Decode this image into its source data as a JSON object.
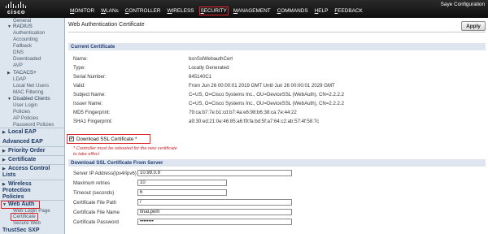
{
  "header": {
    "brand": "cisco",
    "top_right": "Saye Configuration",
    "nav": [
      {
        "key": "M",
        "rest": "ONITOR"
      },
      {
        "key": "W",
        "rest": "LANs"
      },
      {
        "key": "C",
        "rest": "ONTROLLER"
      },
      {
        "key": "W",
        "rest": "IRELESS"
      },
      {
        "key": "S",
        "rest": "ECURITY"
      },
      {
        "key": "M",
        "rest": "ANAGEMENT"
      },
      {
        "key": "C",
        "rest": "OMMANDS"
      },
      {
        "key": "H",
        "rest": "ELP"
      },
      {
        "key": "F",
        "rest": "EEDBACK"
      }
    ],
    "active_nav": "SECURITY",
    "accent_color": "#d8232a"
  },
  "sidebar": {
    "items": [
      {
        "label": "General",
        "type": "sub"
      },
      {
        "label": "RADIUS",
        "type": "parent",
        "expanded": true
      },
      {
        "label": "Authentication",
        "type": "sub"
      },
      {
        "label": "Accounting",
        "type": "sub"
      },
      {
        "label": "Fallback",
        "type": "sub"
      },
      {
        "label": "DNS",
        "type": "sub"
      },
      {
        "label": "Downloaded",
        "type": "sub"
      },
      {
        "label": "AVP",
        "type": "sub"
      },
      {
        "label": "TACACS+",
        "type": "parent",
        "expanded": false
      },
      {
        "label": "LDAP",
        "type": "sub"
      },
      {
        "label": "Local Net Users",
        "type": "sub"
      },
      {
        "label": "MAC Filtering",
        "type": "sub"
      },
      {
        "label": "Disabled Clients",
        "type": "parent",
        "expanded": true
      },
      {
        "label": "User Login",
        "type": "sub"
      },
      {
        "label": "Policies",
        "type": "sub"
      },
      {
        "label": "AP Policies",
        "type": "sub"
      },
      {
        "label": "Password Policies",
        "type": "sub"
      },
      {
        "label": "Local EAP",
        "type": "section",
        "expanded": false
      },
      {
        "label": "Advanced EAP",
        "type": "section"
      },
      {
        "label": "Priority Order",
        "type": "section",
        "expanded": false
      },
      {
        "label": "Certificate",
        "type": "section",
        "expanded": false
      },
      {
        "label": "Access Control",
        "type": "section",
        "expanded": false
      },
      {
        "label": "Lists",
        "type": "section"
      },
      {
        "label": "Wireless",
        "type": "section",
        "expanded": false
      },
      {
        "label": "Protection",
        "type": "section"
      },
      {
        "label": "Policies",
        "type": "section"
      },
      {
        "label": "Web Auth",
        "type": "section",
        "expanded": true
      },
      {
        "label": "Web Login Page",
        "type": "sub"
      },
      {
        "label": "Certificate",
        "type": "sub",
        "selected": true
      },
      {
        "label": "Secure Web",
        "type": "sub"
      },
      {
        "label": "TrustSec SXP",
        "type": "section"
      }
    ]
  },
  "main": {
    "title": "Web Authentication Certificate",
    "apply_label": "Apply",
    "current_section": "Current Certificate",
    "fields": [
      {
        "label": "Name:",
        "value": "bsnSslWebauthCert"
      },
      {
        "label": "Type:",
        "value": "Locally Generated"
      },
      {
        "label": "Serial Number:",
        "value": "845140C1"
      },
      {
        "label": "Valid:",
        "value": "From Jun 26 00:00:01 2019 GMT  Until Jun 26 00:00:01 2029 GMT"
      },
      {
        "label": "Subject Name:",
        "value": "C=US, O=Cisco Systems Inc., OU=DeviceSSL (WebAuth), CN=2.2.2.2"
      },
      {
        "label": "Issuer Name:",
        "value": "C=US, O=Cisco Systems Inc., OU=DeviceSSL (WebAuth), CN=2.2.2.2"
      },
      {
        "label": "MD5 Fingerprint:",
        "value": "79:ca:b7:7e:b1:cd:b7:4a:e6:98:b6:38:ca:7e:44:22"
      },
      {
        "label": "SHA1 Fingerprint:",
        "value": "a9:30:ed:21:0e:46:85:a6:f9:fa:bd:5f:a7:64:c2:ab:57:4f:58:7c"
      }
    ],
    "download_checkbox_label": "Download SSL Certificate *",
    "download_checked": true,
    "reboot_note_line1": "* Controller must be rebooted for the new certificate",
    "reboot_note_line2": "to take effect",
    "download_section": "Download SSL Certificate From Server",
    "form": [
      {
        "label": "Server IP Address(Ipv4/Ipv6)",
        "value": "10.99.0.9"
      },
      {
        "label": "Maximum retries",
        "value": "10"
      },
      {
        "label": "Timeout (seconds)",
        "value": "6"
      },
      {
        "label": "Certificate File Path",
        "value": "/"
      },
      {
        "label": "Certificate File Name",
        "value": "final.pem"
      },
      {
        "label": "Certificate Password",
        "value": "••••••••"
      }
    ]
  }
}
